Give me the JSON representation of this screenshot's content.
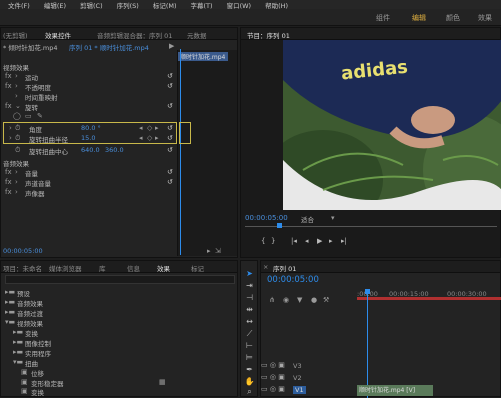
{
  "menu": [
    "文件(F)",
    "编辑(E)",
    "剪辑(C)",
    "序列(S)",
    "标记(M)",
    "字幕(T)",
    "窗口(W)",
    "帮助(H)"
  ],
  "workspaces": [
    "组件",
    "编辑",
    "颜色",
    "效果"
  ],
  "effect_controls": {
    "tabs": [
      "(无剪辑)",
      "效果控件",
      "音频剪辑混合器：序列 01",
      "元数据"
    ],
    "header_clip": "* 倾时针加花.mp4",
    "header_seq": "序列 01 * 顺时针加花.mp4",
    "timeline_clip_label": "顺时针加花.mp4",
    "video_effects_header": "视频效果",
    "motion": "运动",
    "opacity": "不透明度",
    "time_remap": "时间重映射",
    "twirl": "旋转",
    "angle_label": "角度",
    "angle_value": "80.0 °",
    "radius_label": "旋转扭曲半径",
    "radius_value": "15.0",
    "center_label": "旋转扭曲中心",
    "center_x": "640.0",
    "center_y": "360.0",
    "audio_effects_header": "音频效果",
    "volume": "音量",
    "channel_volume": "声道音量",
    "panner": "声像器",
    "timecode": "00:00:05:00"
  },
  "program": {
    "tab": "节目：序列 01",
    "timecode": "00:00:05:00",
    "fit": "适合",
    "shirt_text": "adidas"
  },
  "project_panel": {
    "tabs": [
      "项目：未命名",
      "媒体浏览器",
      "库",
      "信息",
      "效果",
      "标记"
    ],
    "items": [
      "预设",
      "音频效果",
      "音频过渡",
      "视频效果",
      "变换",
      "图像控制",
      "实用程序",
      "扭曲",
      "位移",
      "变形稳定器",
      "变换",
      "放大"
    ]
  },
  "timeline": {
    "tab": "序列 01",
    "timecode": "00:00:05:00",
    "ruler": [
      ":00:00",
      "00:00:15:00",
      "00:00:30:00"
    ],
    "tracks": [
      "V3",
      "V2",
      "V1"
    ],
    "clip_label": "顺时针加花.mp4 [V]"
  },
  "colors": {
    "accent": "#2d8ceb",
    "highlight": "#c8b84a",
    "active_ws": "#e0b040"
  }
}
